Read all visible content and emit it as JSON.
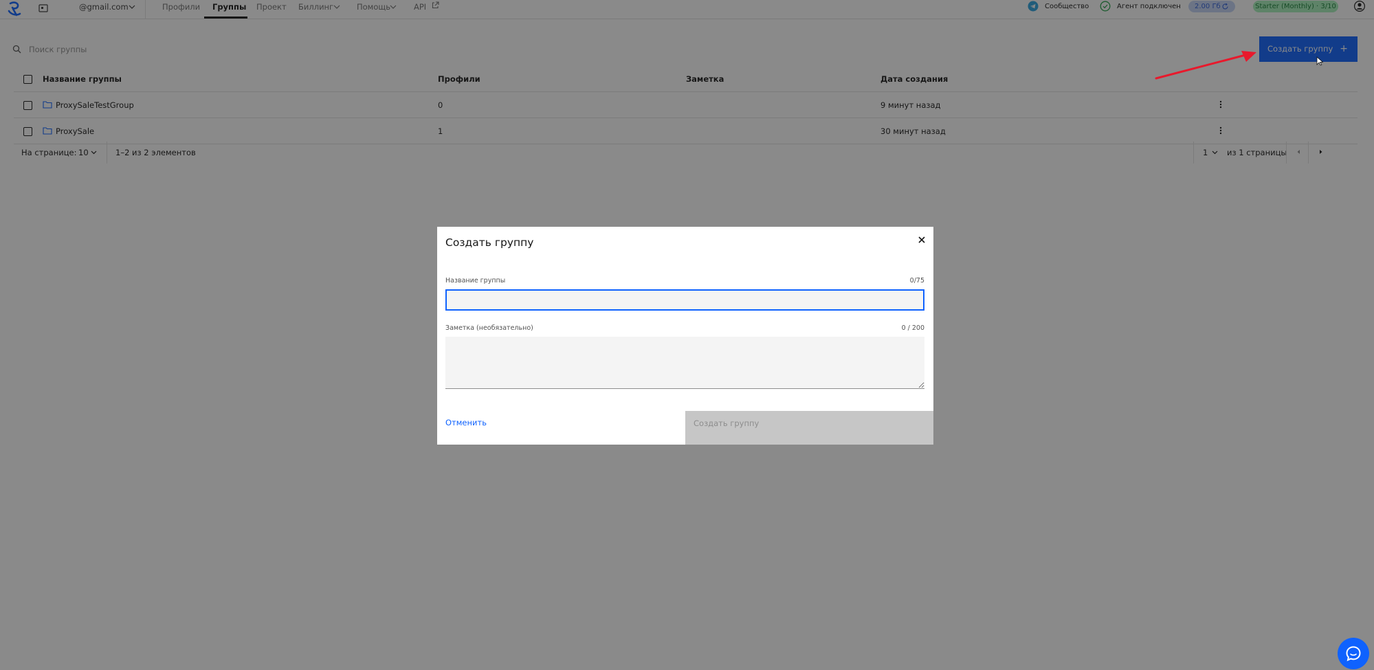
{
  "topbar": {
    "account_email": "@gmail.com",
    "nav": {
      "profiles": "Профили",
      "groups": "Группы",
      "project": "Проект",
      "billing": "Биллинг",
      "help": "Помощь",
      "api": "API"
    },
    "community": "Сообщество",
    "agent_status": "Агент подключен",
    "traffic": "2.00 Гб",
    "plan": "Starter (Monthly) · 3/10"
  },
  "toolbar": {
    "search_placeholder": "Поиск группы",
    "create_label": "Создать группу",
    "create_plus": "+"
  },
  "table": {
    "headers": {
      "name": "Название группы",
      "profiles": "Профили",
      "note": "Заметка",
      "created": "Дата создания"
    },
    "rows": [
      {
        "name": "ProxySaleTestGroup",
        "profiles": "0",
        "note": "",
        "created": "9 минут назад"
      },
      {
        "name": "ProxySale",
        "profiles": "1",
        "note": "",
        "created": "30 минут назад"
      }
    ]
  },
  "pagination": {
    "per_page_label": "На странице:",
    "per_page_value": "10",
    "range": "1–2 из 2 элементов",
    "page_value": "1",
    "page_of": "из 1 страницы"
  },
  "modal": {
    "title": "Создать группу",
    "name_label": "Название группы",
    "name_counter": "0/75",
    "name_value": "",
    "note_label": "Заметка (необязательно)",
    "note_counter": "0 / 200",
    "note_value": "",
    "cancel_label": "Отменить",
    "submit_label": "Создать группу"
  },
  "colors": {
    "primary": "#0f62fe",
    "annotation_arrow": "#e8192c",
    "overlay": "rgba(22,22,22,0.5)"
  },
  "icons": [
    "logo-icon",
    "account-icon",
    "chevron-down-icon",
    "external-link-icon",
    "telegram-icon",
    "check-circle-icon",
    "refresh-icon",
    "user-icon",
    "search-icon",
    "plus-icon",
    "folder-icon",
    "overflow-menu-icon",
    "close-icon",
    "caret-left-icon",
    "caret-right-icon",
    "chat-icon"
  ]
}
